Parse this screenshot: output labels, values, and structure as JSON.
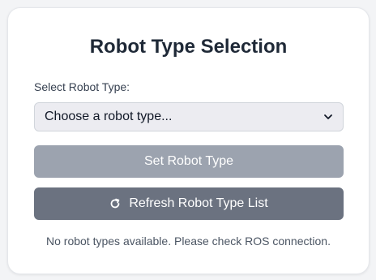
{
  "panel": {
    "title": "Robot Type Selection",
    "select_label": "Select Robot Type:",
    "select_value": "Choose a robot type...",
    "set_button_label": "Set Robot Type",
    "refresh_button_label": "Refresh Robot Type List",
    "status_message": "No robot types available. Please check ROS connection."
  },
  "icons": {
    "select_chevron": "chevron-down-icon",
    "refresh": "refresh-icon"
  },
  "colors": {
    "set_button_bg": "#9ca3af",
    "refresh_button_bg": "#6b7280",
    "title": "#1f2937"
  }
}
